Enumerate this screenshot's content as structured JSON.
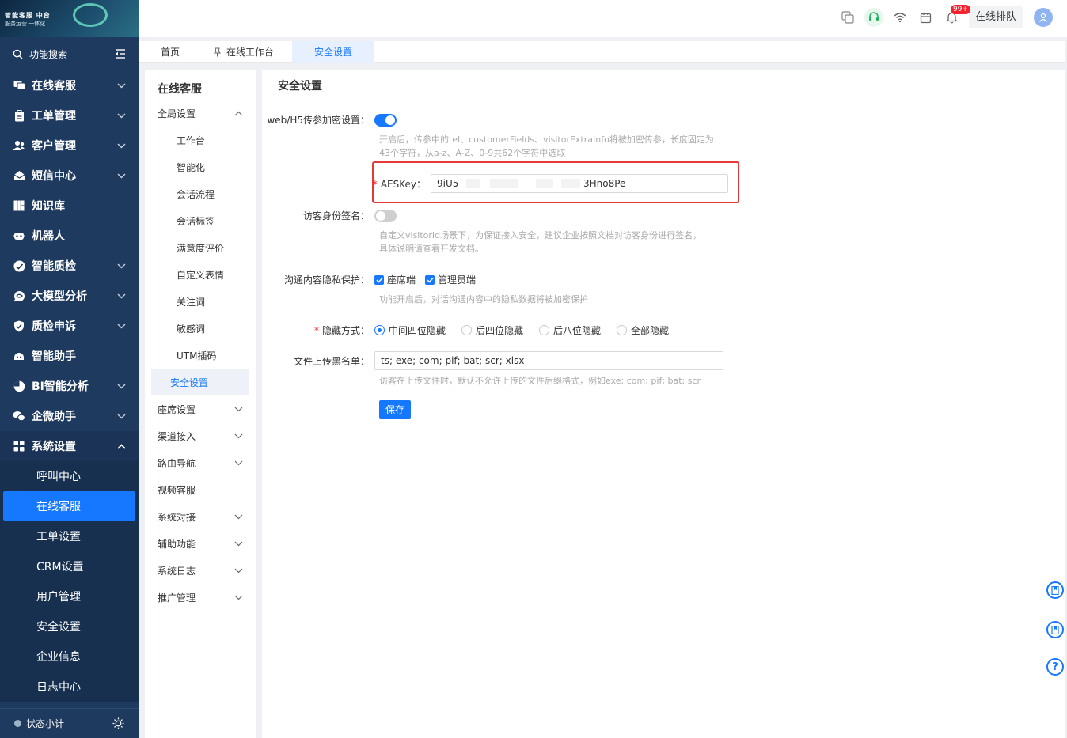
{
  "logo": {
    "line1": "智能客服 中台",
    "line2": "服务运营 一体化"
  },
  "search": {
    "label": "功能搜索"
  },
  "sidebar": {
    "items": [
      {
        "label": "在线客服",
        "icon": "chat-icon",
        "has_chevron": true
      },
      {
        "label": "工单管理",
        "icon": "clipboard-icon",
        "has_chevron": true
      },
      {
        "label": "客户管理",
        "icon": "users-icon",
        "has_chevron": true
      },
      {
        "label": "短信中心",
        "icon": "mail-icon",
        "has_chevron": true
      },
      {
        "label": "知识库",
        "icon": "grid-icon",
        "has_chevron": false
      },
      {
        "label": "机器人",
        "icon": "robot-icon",
        "has_chevron": false
      },
      {
        "label": "智能质检",
        "icon": "check-circle-icon",
        "has_chevron": true
      },
      {
        "label": "大模型分析",
        "icon": "brain-icon",
        "has_chevron": true
      },
      {
        "label": "质检申诉",
        "icon": "shield-icon",
        "has_chevron": true
      },
      {
        "label": "智能助手",
        "icon": "assistant-icon",
        "has_chevron": false
      },
      {
        "label": "BI智能分析",
        "icon": "pie-icon",
        "has_chevron": true
      },
      {
        "label": "企微助手",
        "icon": "wechat-icon",
        "has_chevron": true
      },
      {
        "label": "系统设置",
        "icon": "settings-grid-icon",
        "has_chevron": true
      }
    ],
    "sub_items": [
      "呼叫中心",
      "在线客服",
      "工单设置",
      "CRM设置",
      "用户管理",
      "安全设置",
      "企业信息",
      "日志中心"
    ],
    "status_label": "状态小计"
  },
  "topbar": {
    "badge": "99+",
    "queue": "在线排队"
  },
  "tabs": [
    "首页",
    "在线工作台",
    "安全设置"
  ],
  "subnav": {
    "title": "在线客服",
    "global": "全局设置",
    "children": [
      "工作台",
      "智能化",
      "会话流程",
      "会话标签",
      "满意度评价",
      "自定义表情",
      "关注词",
      "敏感词",
      "UTM插码",
      "安全设置"
    ],
    "groups": [
      {
        "label": "座席设置",
        "has_chevron": true
      },
      {
        "label": "渠道接入",
        "has_chevron": true
      },
      {
        "label": "路由导航",
        "has_chevron": true
      },
      {
        "label": "视频客服",
        "has_chevron": false
      },
      {
        "label": "系统对接",
        "has_chevron": true
      },
      {
        "label": "辅助功能",
        "has_chevron": true
      },
      {
        "label": "系统日志",
        "has_chevron": true
      },
      {
        "label": "推广管理",
        "has_chevron": true
      }
    ]
  },
  "main": {
    "title": "安全设置",
    "web_encrypt": {
      "label": "web/H5传参加密设置：",
      "enabled": true,
      "hint1": "开启后，传参中的tel、customerFields、visitorExtraInfo将被加密传参，长度固定为",
      "hint2": "43个字符，从a-z、A-Z、0-9共62个字符中选取"
    },
    "aes": {
      "label": "AESKey：",
      "prefix": "9iU5",
      "suffix": "3Hno8Pe"
    },
    "visitor_sign": {
      "label": "访客身份签名：",
      "enabled": false,
      "hint1": "自定义visitorId场景下，为保证接入安全，建议企业按照文档对访客身份进行签名，",
      "hint2": "具体说明请查看开发文档。"
    },
    "privacy": {
      "label": "沟通内容隐私保护：",
      "options": [
        "座席端",
        "管理员端"
      ],
      "hint": "功能开启后，对话沟通内容中的隐私数据将被加密保护"
    },
    "hide_mode": {
      "label": "隐藏方式：",
      "options": [
        "中间四位隐藏",
        "后四位隐藏",
        "后八位隐藏",
        "全部隐藏"
      ],
      "selected": "中间四位隐藏"
    },
    "blacklist": {
      "label": "文件上传黑名单：",
      "value": "ts; exe; com; pif; bat; scr; xlsx",
      "hint": "访客在上传文件时，默认不允许上传的文件后缀格式，例如exe; com; pif; bat; scr"
    },
    "save": "保存"
  }
}
